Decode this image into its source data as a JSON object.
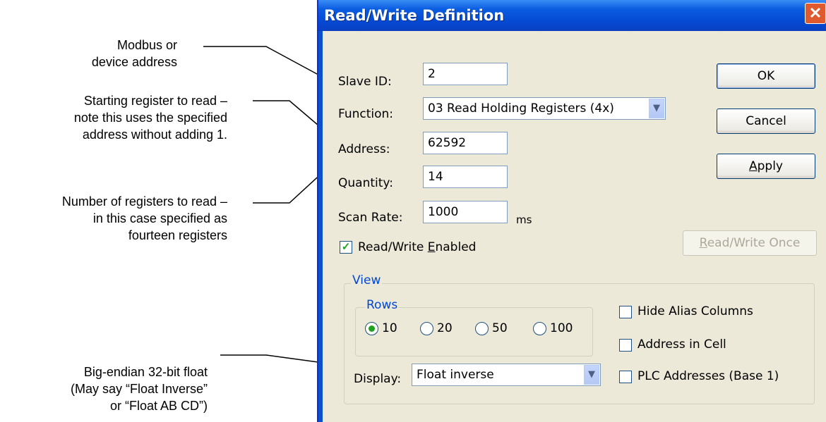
{
  "annotations": [
    {
      "lines": [
        "Modbus or",
        "device address"
      ]
    },
    {
      "lines": [
        "Starting register to read –",
        "note this uses the specified",
        "address without adding 1."
      ]
    },
    {
      "lines": [
        "Number of registers to read –",
        "in this case specified as",
        "fourteen registers"
      ]
    },
    {
      "lines": [
        "Big-endian 32-bit float",
        "(May say “Float Inverse”",
        "or “Float AB CD”)"
      ]
    }
  ],
  "dialog": {
    "title": "Read/Write Definition",
    "close_glyph": "✕",
    "slave_id": {
      "label": "Slave ID:",
      "value": "2"
    },
    "function": {
      "label": "Function:",
      "value": "03 Read Holding Registers (4x)"
    },
    "address": {
      "label": "Address:",
      "value": "62592"
    },
    "quantity": {
      "label": "Quantity:",
      "value": "14"
    },
    "scan_rate": {
      "label": "Scan Rate:",
      "value": "1000",
      "unit": "ms"
    },
    "enabled": {
      "label_pre": "Read/Write ",
      "label_u": "E",
      "label_post": "nabled",
      "checked": true
    },
    "buttons": {
      "ok": "OK",
      "cancel": "Cancel",
      "apply_u": "A",
      "apply_rest": "pply",
      "once_u": "R",
      "once_rest": "ead/Write Once"
    },
    "view": {
      "label": "View",
      "rows_label": "Rows",
      "rows": [
        {
          "label": "10",
          "selected": true
        },
        {
          "label": "20",
          "selected": false
        },
        {
          "label": "50",
          "selected": false
        },
        {
          "label": "100",
          "selected": false
        }
      ],
      "display_label": "Display:",
      "display_value": "Float inverse",
      "options": [
        {
          "label": "Hide Alias Columns",
          "checked": false
        },
        {
          "label": "Address in Cell",
          "checked": false
        },
        {
          "label": "PLC Addresses (Base 1)",
          "checked": false
        }
      ]
    },
    "icons": {
      "dropdown": "chevron-down-icon",
      "check": "checkmark-icon"
    }
  }
}
